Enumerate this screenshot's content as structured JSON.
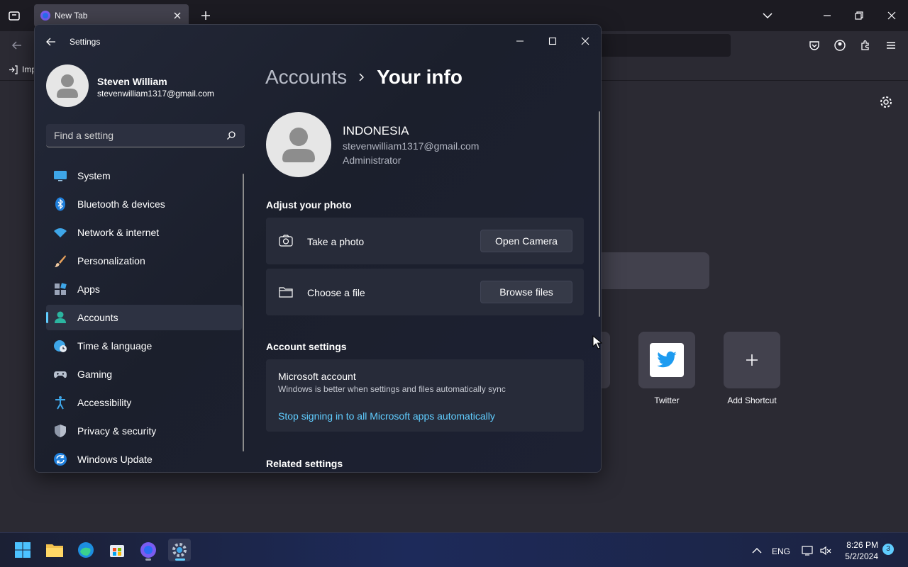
{
  "browser": {
    "tab_title": "New Tab",
    "bookmark_item": "Imp",
    "shortcuts": [
      {
        "label": "Twitter"
      },
      {
        "label": "Add Shortcut"
      }
    ]
  },
  "settings": {
    "app_title": "Settings",
    "profile": {
      "name": "Steven William",
      "email": "stevenwilliam1317@gmail.com"
    },
    "search": {
      "placeholder": "Find a setting"
    },
    "nav": [
      {
        "label": "System",
        "icon": "monitor-icon"
      },
      {
        "label": "Bluetooth & devices",
        "icon": "bluetooth-icon"
      },
      {
        "label": "Network & internet",
        "icon": "wifi-icon"
      },
      {
        "label": "Personalization",
        "icon": "brush-icon"
      },
      {
        "label": "Apps",
        "icon": "apps-icon"
      },
      {
        "label": "Accounts",
        "icon": "person-icon",
        "active": true
      },
      {
        "label": "Time & language",
        "icon": "globe-clock-icon"
      },
      {
        "label": "Gaming",
        "icon": "gamepad-icon"
      },
      {
        "label": "Accessibility",
        "icon": "accessibility-icon"
      },
      {
        "label": "Privacy & security",
        "icon": "shield-icon"
      },
      {
        "label": "Windows Update",
        "icon": "update-icon"
      }
    ],
    "breadcrumb": {
      "parent": "Accounts",
      "current": "Your info"
    },
    "user": {
      "name": "INDONESIA",
      "email": "stevenwilliam1317@gmail.com",
      "role": "Administrator"
    },
    "adjust_photo": {
      "title": "Adjust your photo",
      "take_photo_label": "Take a photo",
      "take_photo_button": "Open Camera",
      "choose_file_label": "Choose a file",
      "choose_file_button": "Browse files"
    },
    "account_settings": {
      "title": "Account settings",
      "ms_title": "Microsoft account",
      "ms_subtitle": "Windows is better when settings and files automatically sync",
      "ms_link": "Stop signing in to all Microsoft apps automatically"
    },
    "related_settings_title": "Related settings"
  },
  "taskbar": {
    "language": "ENG",
    "time": "8:26 PM",
    "date": "5/2/2024",
    "notification_count": "3"
  },
  "colors": {
    "accent": "#60cdff",
    "settings_bg": "#1d2130",
    "browser_bg": "#2b2a33"
  }
}
